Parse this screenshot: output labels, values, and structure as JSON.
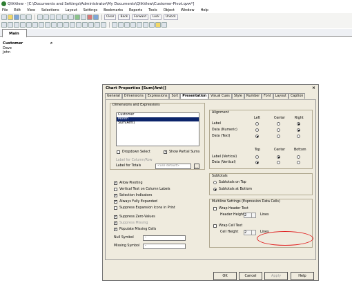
{
  "window": {
    "title": "QlikView - [C:\\Documents and Settings\\Administrator\\My Documents\\QlikView\\Customer-Pivot.qvw*]"
  },
  "menu": [
    "File",
    "Edit",
    "View",
    "Selections",
    "Layout",
    "Settings",
    "Bookmarks",
    "Reports",
    "Tools",
    "Object",
    "Window",
    "Help"
  ],
  "toolbar": {
    "clear": "Clear",
    "back": "Back",
    "forward": "Forward",
    "lock": "Lock",
    "unlock": "Unlock"
  },
  "sheet_tab": "Main",
  "listbox": {
    "title": "Customer",
    "items": [
      "Dave",
      "John"
    ]
  },
  "dialog": {
    "title": "Chart Properties [Sum(Amt)]",
    "tabs": [
      "General",
      "Dimensions",
      "Expressions",
      "Sort",
      "Presentation",
      "Visual Cues",
      "Style",
      "Number",
      "Font",
      "Layout",
      "Caption"
    ],
    "dims_group": "Dimensions and Expressions",
    "dim_items": [
      "Customer",
      "Month",
      "Sum(Amt)"
    ],
    "dropdown_select": "Dropdown Select",
    "show_partial_sums": "Show Partial Sums",
    "label_col_row": "Label for Column/Row",
    "label_totals": "Label for Totals",
    "totals_placeholder": "<use default>",
    "alignment": {
      "group": "Alignment",
      "left": "Left",
      "center": "Center",
      "right": "Right",
      "top": "Top",
      "bottom": "Bottom",
      "label": "Label",
      "data_numeric": "Data (Numeric)",
      "data_text": "Data (Text)",
      "label_vertical": "Label (Vertical)",
      "data_vertical": "Data (Vertical)"
    },
    "options": [
      "Allow Pivoting",
      "Vertical Text on Column Labels",
      "Selection Indicators",
      "Always Fully Expanded",
      "Suppress Expansion Icons in Print",
      "Suppress Zero-Values",
      "Suppress Missing",
      "Populate Missing Cells"
    ],
    "null_symbol": "Null Symbol",
    "null_value": "-",
    "missing_symbol": "Missing Symbol",
    "missing_value": "-",
    "subtotals": {
      "group": "Subtotals",
      "on_top": "Subtotals on Top",
      "at_bottom": "Subtotals at Bottom"
    },
    "multiline": {
      "group": "Multiline Settings (Expression Data Cells)",
      "wrap_header": "Wrap Header Text",
      "header_height": "Header Height",
      "header_val": "2",
      "lines": "Lines",
      "wrap_cell": "Wrap Cell Text",
      "cell_height": "Cell Height",
      "cell_val": "2"
    },
    "buttons": {
      "ok": "OK",
      "cancel": "Cancel",
      "apply": "Apply",
      "help": "Help"
    }
  },
  "colors": {
    "selection": "#0b246a",
    "highlight": "#e02020",
    "dialog_bg": "#efebde"
  }
}
